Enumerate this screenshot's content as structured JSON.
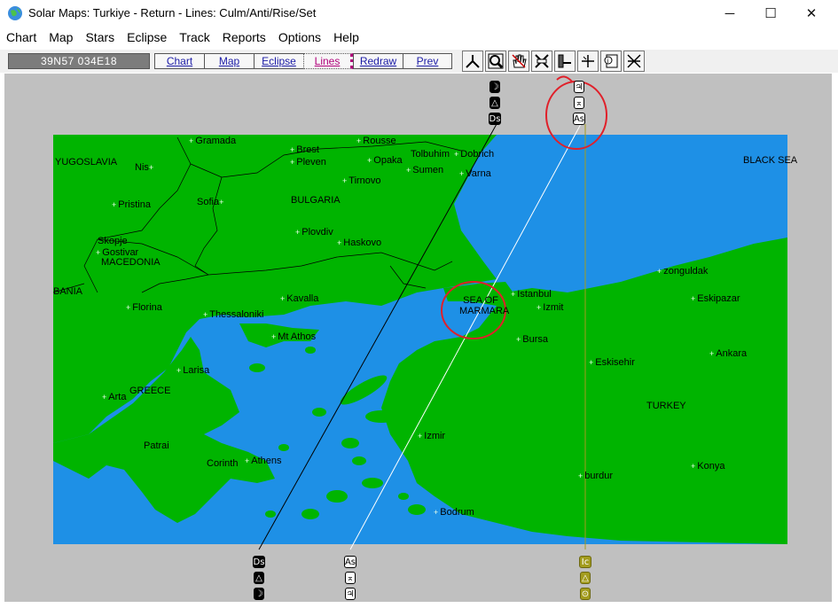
{
  "window": {
    "title": "Solar Maps: Turkiye - Return - Lines: Culm/Anti/Rise/Set",
    "minimize": "─",
    "maximize": "☐",
    "close": "✕"
  },
  "menu": [
    "Chart",
    "Map",
    "Stars",
    "Eclipse",
    "Track",
    "Reports",
    "Options",
    "Help"
  ],
  "toolbar": {
    "coordinates": "39N57  034E18",
    "buttons": [
      "Chart",
      "Map",
      "Eclipse",
      "Lines",
      "Redraw",
      "Prev"
    ],
    "active_button": "Lines",
    "icons": [
      "compass-icon",
      "zoom-icon",
      "hand-icon",
      "no-lines-icon",
      "bar-icon",
      "crosshair-icon",
      "info-icon",
      "cross-lines-icon"
    ]
  },
  "map": {
    "colors": {
      "land": "#00b400",
      "sea": "#1e90e6",
      "border": "#000000",
      "frame": "#c0c0c0",
      "annotation": "#e0202a",
      "olive": "#a39c1e"
    },
    "regions": [
      {
        "name": "YUGOSLAVIA"
      },
      {
        "name": "BULGARIA"
      },
      {
        "name": "MACEDONIA"
      },
      {
        "name": "GREECE"
      },
      {
        "name": "TURKEY"
      },
      {
        "name": "BLACK SEA"
      },
      {
        "name": "SEA OF MARMARA"
      },
      {
        "name": "BANIA"
      }
    ],
    "cities": [
      "Gramada",
      "Brest",
      "Rousse",
      "Pleven",
      "Opaka",
      "Tolbuhim",
      "Dobrich",
      "Nis",
      "Sumen",
      "Varna",
      "Tirnovo",
      "Pristina",
      "Sofia",
      "Plovdiv",
      "Haskovo",
      "Skopje",
      "Gostivar",
      "Florina",
      "Kavalla",
      "Thessaloniki",
      "Mt Athos",
      "Istanbul",
      "Izmit",
      "Bursa",
      "zonguldak",
      "Eskipazar",
      "Eskisehir",
      "Ankara",
      "Larisa",
      "Arta",
      "Izmir",
      "Patrai",
      "Corinth",
      "Athens",
      "burdur",
      "Konya",
      "Bodrum"
    ],
    "planet_labels": {
      "top_black": [
        "☽",
        "△",
        "Ds"
      ],
      "top_white": [
        "♃",
        "⌅",
        "As"
      ],
      "bottom_black": [
        "Ds",
        "△",
        "☽"
      ],
      "bottom_white": [
        "As",
        "⌅",
        "♃"
      ],
      "bottom_olive": [
        "Ic",
        "△",
        "⊙"
      ]
    }
  }
}
